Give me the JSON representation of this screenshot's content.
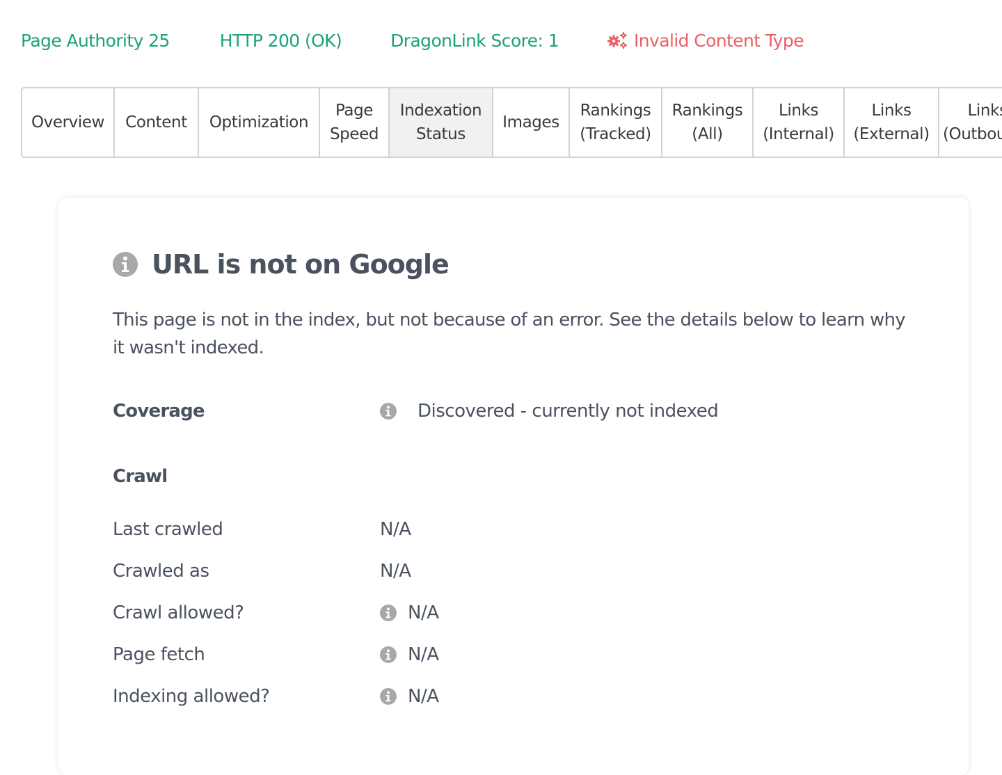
{
  "stats": {
    "page_authority": "Page Authority 25",
    "http_status": "HTTP 200 (OK)",
    "dragonlink_score": "DragonLink Score: 1",
    "content_type_error": "Invalid Content Type",
    "error_icon": "gears-icon"
  },
  "colors": {
    "stat_green": "#1aa37c",
    "error_red": "#ec5f64",
    "text_dark": "#4a5260",
    "info_icon_gray": "#a8a8a8",
    "active_tab_bg": "#f1f1f1"
  },
  "tabs": [
    {
      "line1": "Overview",
      "line2": ""
    },
    {
      "line1": "Content",
      "line2": ""
    },
    {
      "line1": "Optimization",
      "line2": ""
    },
    {
      "line1": "Page",
      "line2": "Speed"
    },
    {
      "line1": "Indexation",
      "line2": "Status",
      "active": true
    },
    {
      "line1": "Images",
      "line2": ""
    },
    {
      "line1": "Rankings",
      "line2": "(Tracked)"
    },
    {
      "line1": "Rankings",
      "line2": "(All)"
    },
    {
      "line1": "Links",
      "line2": "(Internal)"
    },
    {
      "line1": "Links",
      "line2": "(External)"
    },
    {
      "line1": "Links",
      "line2": "(Outbound)"
    }
  ],
  "card": {
    "title": "URL is not on Google",
    "title_icon": "info-circle-icon",
    "description": "This page is not in the index, but not because of an error. See the details below to learn why it wasn't indexed.",
    "coverage": {
      "label": "Coverage",
      "value": "Discovered - currently not indexed",
      "icon": "info-circle-icon"
    },
    "crawl": {
      "heading": "Crawl",
      "rows": [
        {
          "label": "Last crawled",
          "value": "N/A",
          "icon": null
        },
        {
          "label": "Crawled as",
          "value": "N/A",
          "icon": null
        },
        {
          "label": "Crawl allowed?",
          "value": "N/A",
          "icon": "info-circle-icon"
        },
        {
          "label": "Page fetch",
          "value": "N/A",
          "icon": "info-circle-icon"
        },
        {
          "label": "Indexing allowed?",
          "value": "N/A",
          "icon": "info-circle-icon"
        }
      ]
    }
  }
}
